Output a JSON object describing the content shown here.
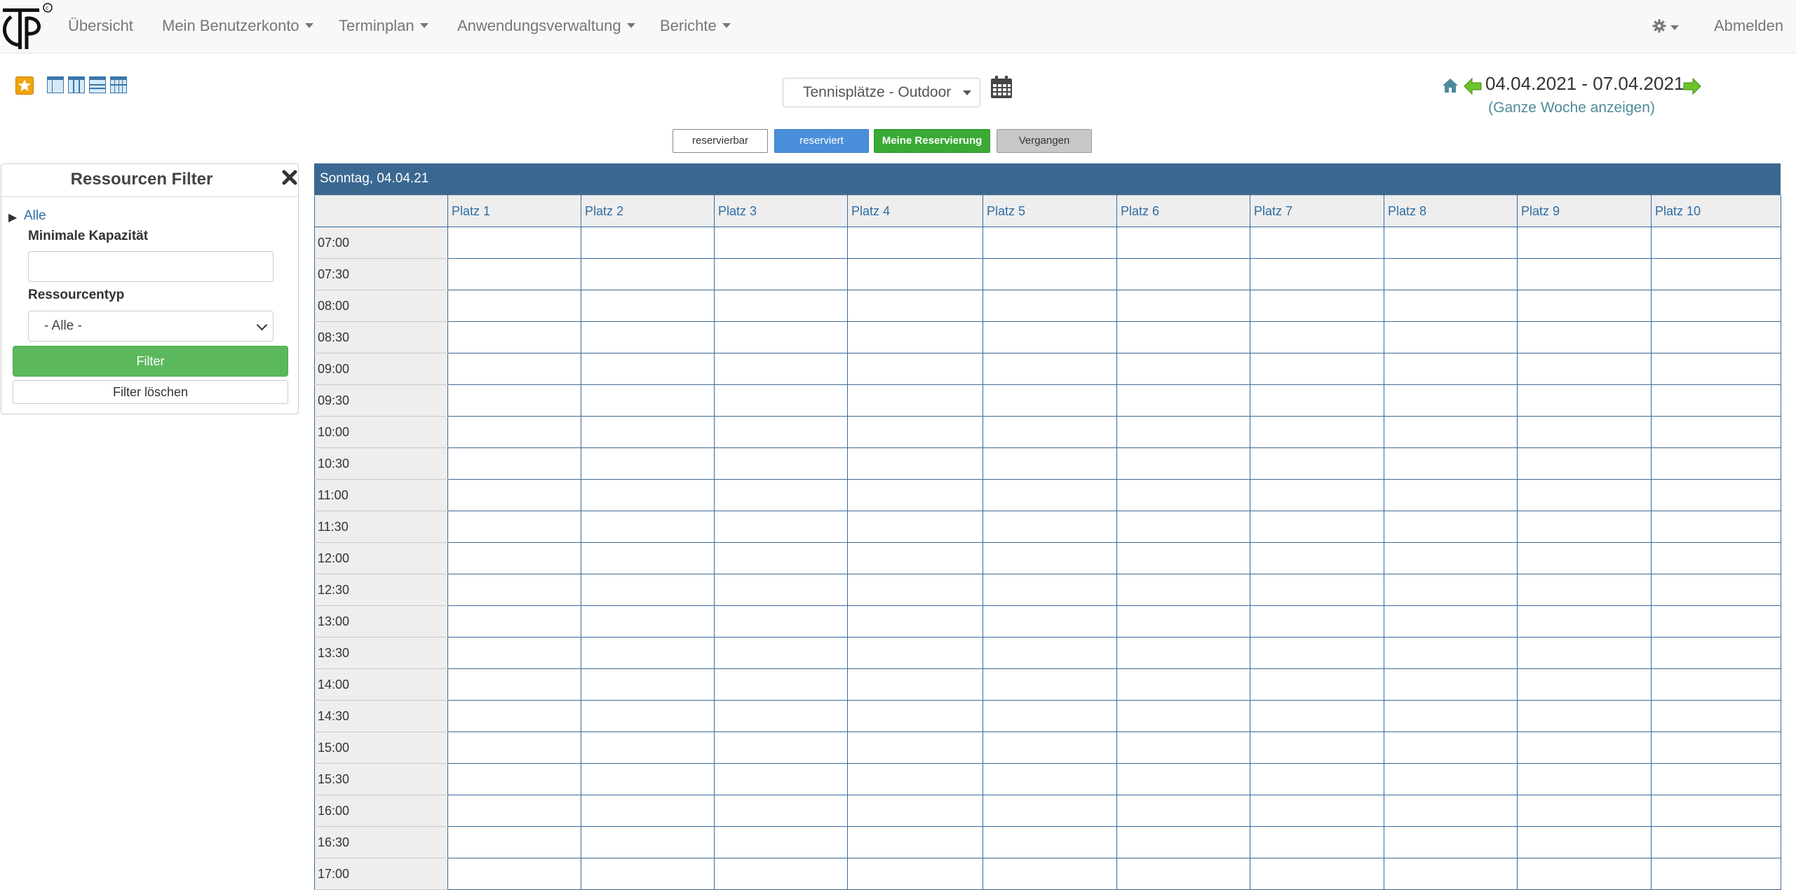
{
  "nav": {
    "items": [
      {
        "label": "Übersicht",
        "dropdown": false
      },
      {
        "label": "Mein Benutzerkonto",
        "dropdown": true
      },
      {
        "label": "Terminplan",
        "dropdown": true
      },
      {
        "label": "Anwendungsverwaltung",
        "dropdown": true
      },
      {
        "label": "Berichte",
        "dropdown": true
      }
    ],
    "logout": "Abmelden",
    "settings_icon": "gear-icon"
  },
  "toolbar": {
    "schedule_selected": "Tennisplätze - Outdoor",
    "date_range": "04.04.2021 - 07.04.2021",
    "week_link": "(Ganze Woche anzeigen)"
  },
  "legend": {
    "free": "reservierbar",
    "reserved": "reserviert",
    "mine": "Meine Reservierung",
    "past": "Vergangen"
  },
  "filter": {
    "title": "Ressourcen Filter",
    "tree_toggle": "▶",
    "tree_all": "Alle",
    "min_capacity_label": "Minimale Kapazität",
    "min_capacity_value": "",
    "resource_type_label": "Ressourcentyp",
    "resource_type_value": "- Alle -",
    "filter_button": "Filter",
    "clear_button": "Filter löschen"
  },
  "schedule": {
    "day_header": "Sonntag, 04.04.21",
    "resources": [
      "Platz 1",
      "Platz 2",
      "Platz 3",
      "Platz 4",
      "Platz 5",
      "Platz 6",
      "Platz 7",
      "Platz 8",
      "Platz 9",
      "Platz 10"
    ],
    "times": [
      "07:00",
      "07:30",
      "08:00",
      "08:30",
      "09:00",
      "09:30",
      "10:00",
      "10:30",
      "11:00",
      "11:30",
      "12:00",
      "12:30",
      "13:00",
      "13:30",
      "14:00",
      "14:30",
      "15:00",
      "15:30",
      "16:00",
      "16:30",
      "17:00"
    ]
  },
  "colors": {
    "header_blue": "#3a6890",
    "reserved": "#4a8fd9",
    "mine": "#3aaa35",
    "past": "#c8c8c8",
    "filter_green": "#5cb85c"
  }
}
